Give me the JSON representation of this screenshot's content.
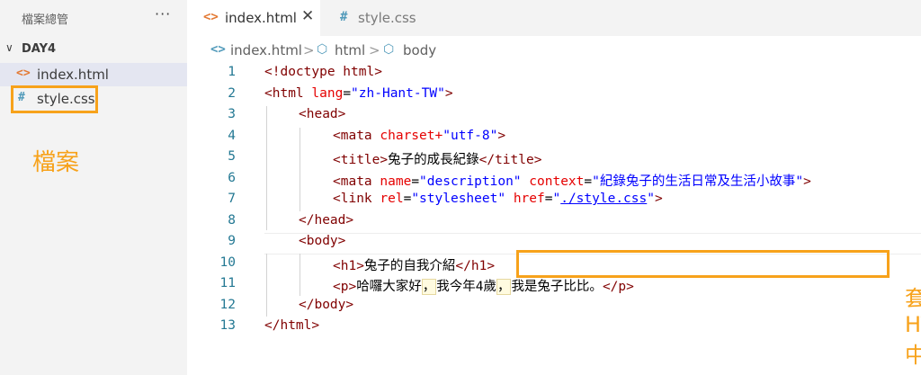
{
  "sidebar": {
    "title": "檔案總管",
    "more": "···",
    "folder": {
      "chevron": "∨",
      "name": "DAY4"
    },
    "files": [
      {
        "icon": "<>",
        "name": "index.html"
      },
      {
        "icon": "#",
        "name": "style.css"
      }
    ],
    "annotation": "檔案"
  },
  "tabs": [
    {
      "icon": "<>",
      "label": "index.html",
      "close": "✕"
    },
    {
      "icon": "#",
      "label": "style.css"
    }
  ],
  "breadcrumb": {
    "items": [
      {
        "icon": "<>",
        "label": "index.html"
      },
      {
        "icon": "⬡",
        "label": "html"
      },
      {
        "icon": "⬡",
        "label": "body"
      }
    ],
    "separator": ">"
  },
  "editor": {
    "line_numbers": [
      "1",
      "2",
      "3",
      "4",
      "5",
      "6",
      "7",
      "8",
      "9",
      "10",
      "11",
      "12",
      "13"
    ],
    "lines": [
      [
        [
          "t-tag",
          "<!doctype html>"
        ]
      ],
      [
        [
          "t-tag",
          "<html "
        ],
        [
          "t-attr",
          "lang"
        ],
        [
          "t-txt",
          "="
        ],
        [
          "t-val",
          "\"zh-Hant-TW\""
        ],
        [
          "t-tag",
          ">"
        ]
      ],
      [
        [
          "t-tag",
          "<head>"
        ]
      ],
      [
        [
          "t-tag",
          "<mata "
        ],
        [
          "t-attr",
          "charset+"
        ],
        [
          "t-val",
          "\"utf-8\""
        ],
        [
          "t-tag",
          ">"
        ]
      ],
      [
        [
          "t-tag",
          "<title>"
        ],
        [
          "t-txt",
          "兔子的成長紀錄"
        ],
        [
          "t-tag",
          "</title>"
        ]
      ],
      [
        [
          "t-tag",
          "<mata "
        ],
        [
          "t-attr",
          "name"
        ],
        [
          "t-txt",
          "="
        ],
        [
          "t-val",
          "\"description\""
        ],
        [
          "t-txt",
          " "
        ],
        [
          "t-attr",
          "context"
        ],
        [
          "t-txt",
          "="
        ],
        [
          "t-val",
          "\"紀錄兔子的生活日常及生活小故事\""
        ],
        [
          "t-tag",
          ">"
        ]
      ],
      [
        [
          "t-tag",
          "<link "
        ],
        [
          "t-attr",
          "rel"
        ],
        [
          "t-txt",
          "="
        ],
        [
          "t-val",
          "\"stylesheet\""
        ],
        [
          "t-txt",
          " "
        ],
        [
          "t-attr",
          "href"
        ],
        [
          "t-txt",
          "="
        ],
        [
          "t-val",
          "\""
        ],
        [
          "t-link",
          "./style.css"
        ],
        [
          "t-val",
          "\""
        ],
        [
          "t-tag",
          ">"
        ]
      ],
      [
        [
          "t-tag",
          "</head>"
        ]
      ],
      [
        [
          "t-tag",
          "<body>"
        ]
      ],
      [
        [
          "t-tag",
          "<h1>"
        ],
        [
          "t-txt",
          "兔子的自我介紹"
        ],
        [
          "t-tag",
          "</h1>"
        ]
      ],
      [
        [
          "t-tag",
          "<p>"
        ],
        [
          "t-txt",
          "哈囉大家好"
        ],
        [
          "t-hl",
          "，"
        ],
        [
          "t-txt",
          "我今年4歲"
        ],
        [
          "t-hl",
          "，"
        ],
        [
          "t-txt",
          "我是兔子比比。"
        ],
        [
          "t-tag",
          "</p>"
        ]
      ],
      [
        [
          "t-tag",
          "</body>"
        ]
      ],
      [
        [
          "t-tag",
          "</html>"
        ]
      ]
    ],
    "annotation": "套入HTML中"
  },
  "colors": {
    "accent_orange": "#f7a21b",
    "html_icon": "#e37933",
    "css_icon": "#519aba"
  }
}
